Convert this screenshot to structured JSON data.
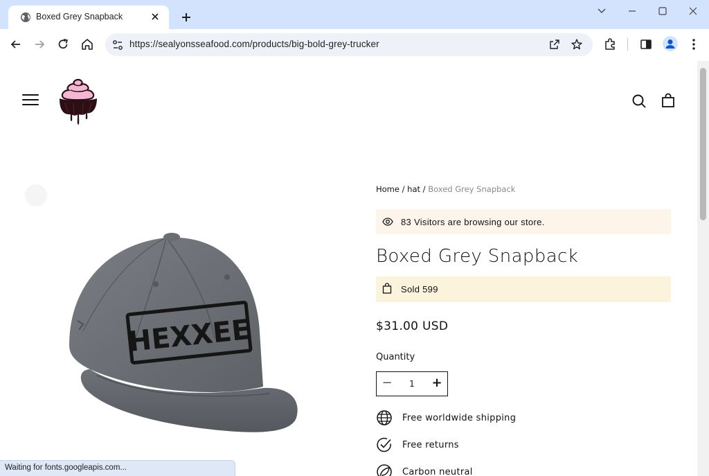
{
  "browser": {
    "tab_title": "Boxed Grey Snapback",
    "url": "https://sealyonsseafood.com/products/big-bold-grey-trucker",
    "status_text": "Waiting for fonts.googleapis.com..."
  },
  "header": {
    "logo_icon": "cupcake-logo",
    "menu_icon": "hamburger-icon",
    "search_icon": "search-icon",
    "cart_icon": "bag-icon"
  },
  "product": {
    "breadcrumb": {
      "home": "Home",
      "sep1": " / ",
      "category": "hat",
      "sep2": " / ",
      "current": "Boxed Grey Snapback"
    },
    "visitors_text": "83 Visitors are browsing our store.",
    "title": "Boxed Grey Snapback",
    "sold_text": "Sold 599",
    "price": "$31.00 USD",
    "quantity_label": "Quantity",
    "quantity_value": "1",
    "cap_text": "HEXXEE",
    "features": [
      {
        "icon": "globe-icon",
        "label": "Free worldwide shipping"
      },
      {
        "icon": "check-circle-icon",
        "label": "Free returns"
      },
      {
        "icon": "leaf-icon",
        "label": "Carbon neutral"
      }
    ]
  }
}
